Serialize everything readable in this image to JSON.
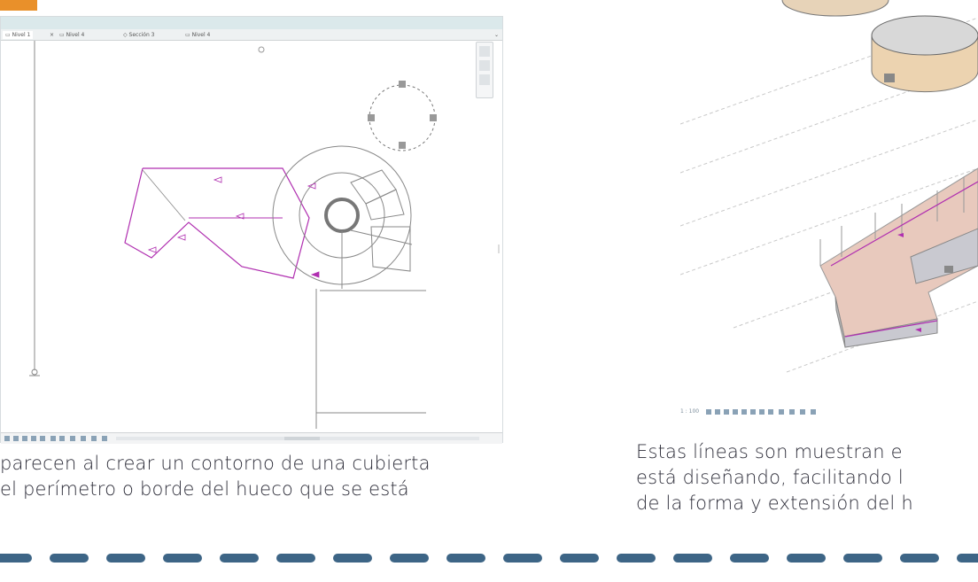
{
  "left_window": {
    "tabs": [
      {
        "label": "Nivel 1",
        "close": "×"
      },
      {
        "label": "Nivel 4"
      },
      {
        "label": "Sección 3"
      },
      {
        "label": "Nivel 4"
      }
    ]
  },
  "right_view": {
    "scale_label": "1 : 100"
  },
  "captions": {
    "left": [
      "parecen al crear un contorno de una cubierta",
      "el perímetro o borde del hueco que se está"
    ],
    "right": [
      "Estas líneas son muestran e",
      "está diseñando, facilitando l",
      "de la forma y extensión del h"
    ]
  },
  "colors": {
    "accent": "#e9902a",
    "dash": "#3d6586",
    "sketch": "#b02fb0",
    "roof_fill": "#e8c9bd"
  }
}
